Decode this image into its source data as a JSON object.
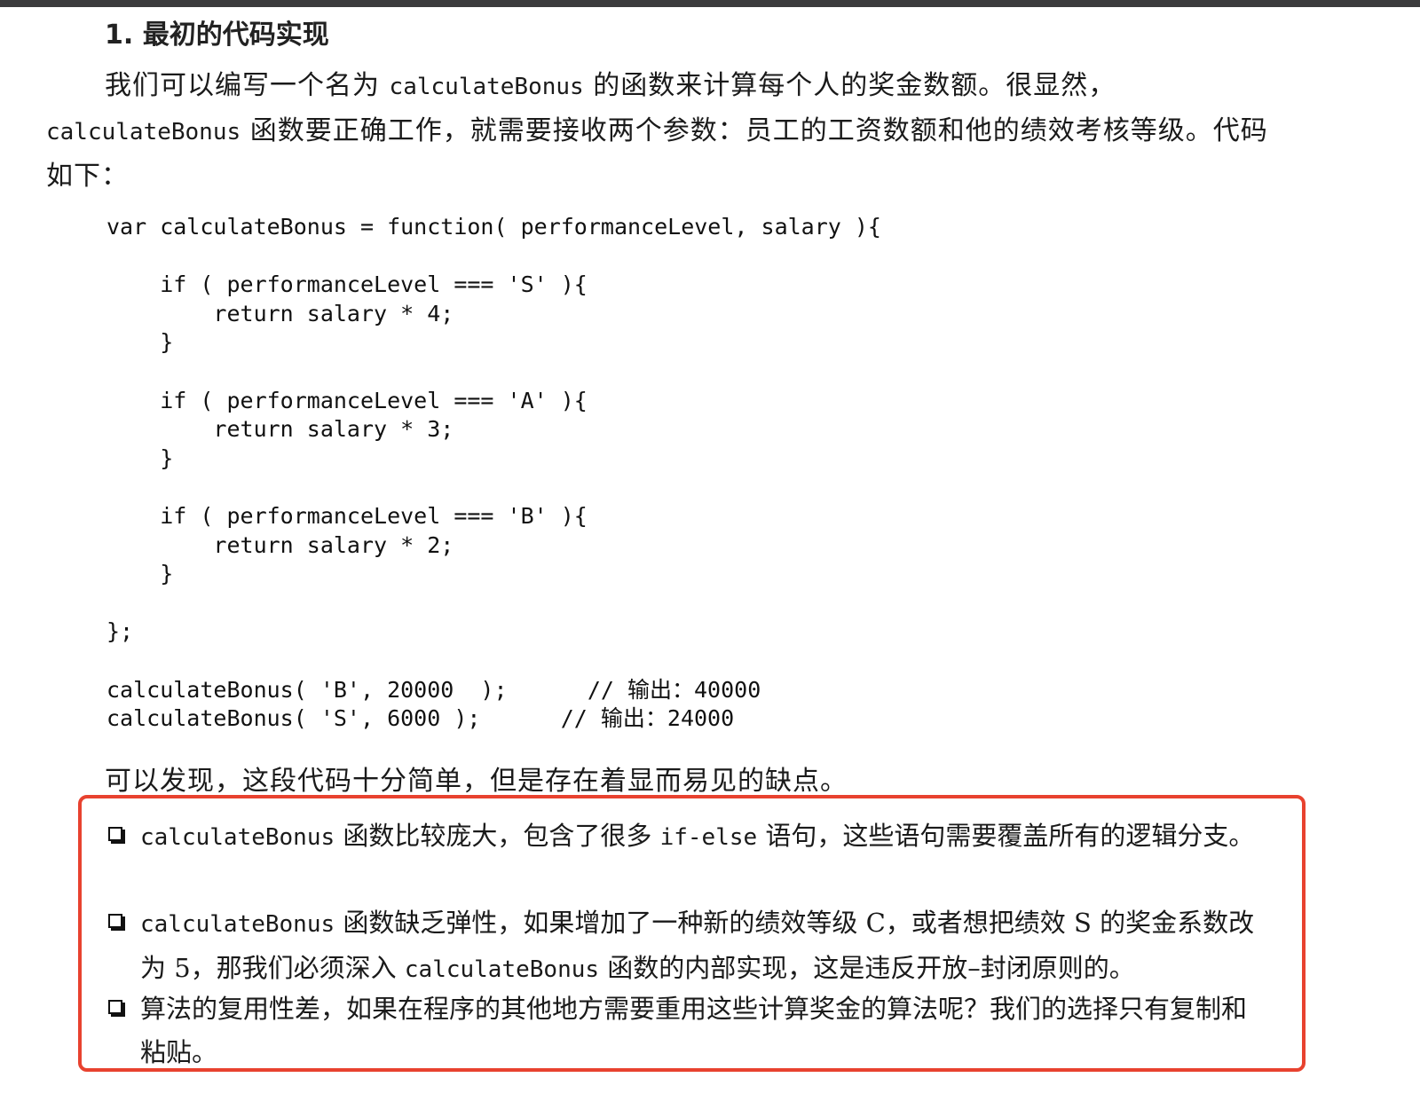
{
  "section_title": "1. 最初的代码实现",
  "intro": {
    "part1": "我们可以编写一个名为",
    "fn1": "calculateBonus",
    "part2": "的函数来计算每个人的奖金数额。很显然，",
    "fn2": "calculateBonus",
    "part3": "函数要正确工作，就需要接收两个参数：员工的工资数额和他的绩效考核等级。代码如下："
  },
  "code_lines": [
    "var calculateBonus = function( performanceLevel, salary ){",
    "",
    "    if ( performanceLevel === 'S' ){",
    "        return salary * 4;",
    "    }",
    "",
    "    if ( performanceLevel === 'A' ){",
    "        return salary * 3;",
    "    }",
    "",
    "    if ( performanceLevel === 'B' ){",
    "        return salary * 2;",
    "    }",
    "",
    "};",
    "",
    "calculateBonus( 'B', 20000  );      // 输出：40000",
    "calculateBonus( 'S', 6000 );      // 输出：24000"
  ],
  "summary": "可以发现，这段代码十分简单，但是存在着显而易见的缺点。",
  "drawbacks": [
    {
      "parts": [
        {
          "t": "calculateBonus",
          "mono": true
        },
        {
          "t": " 函数比较庞大，包含了很多 "
        },
        {
          "t": "if-else",
          "mono": true
        },
        {
          "t": " 语句，这些语句需要覆盖所有的逻辑分支。"
        }
      ]
    },
    {
      "parts": [
        {
          "t": "calculateBonus",
          "mono": true
        },
        {
          "t": " 函数缺乏弹性，如果增加了一种新的绩效等级 C，或者想把绩效 S 的奖金系数改为 5，那我们必须深入 "
        },
        {
          "t": "calculateBonus",
          "mono": true
        },
        {
          "t": " 函数的内部实现，这是违反开放–封闭原则的。"
        }
      ]
    },
    {
      "parts": [
        {
          "t": "算法的复用性差，如果在程序的其他地方需要重用这些计算奖金的算法呢？我们的选择只有复制和粘贴。"
        }
      ]
    }
  ],
  "highlight_color": "#e8422f"
}
